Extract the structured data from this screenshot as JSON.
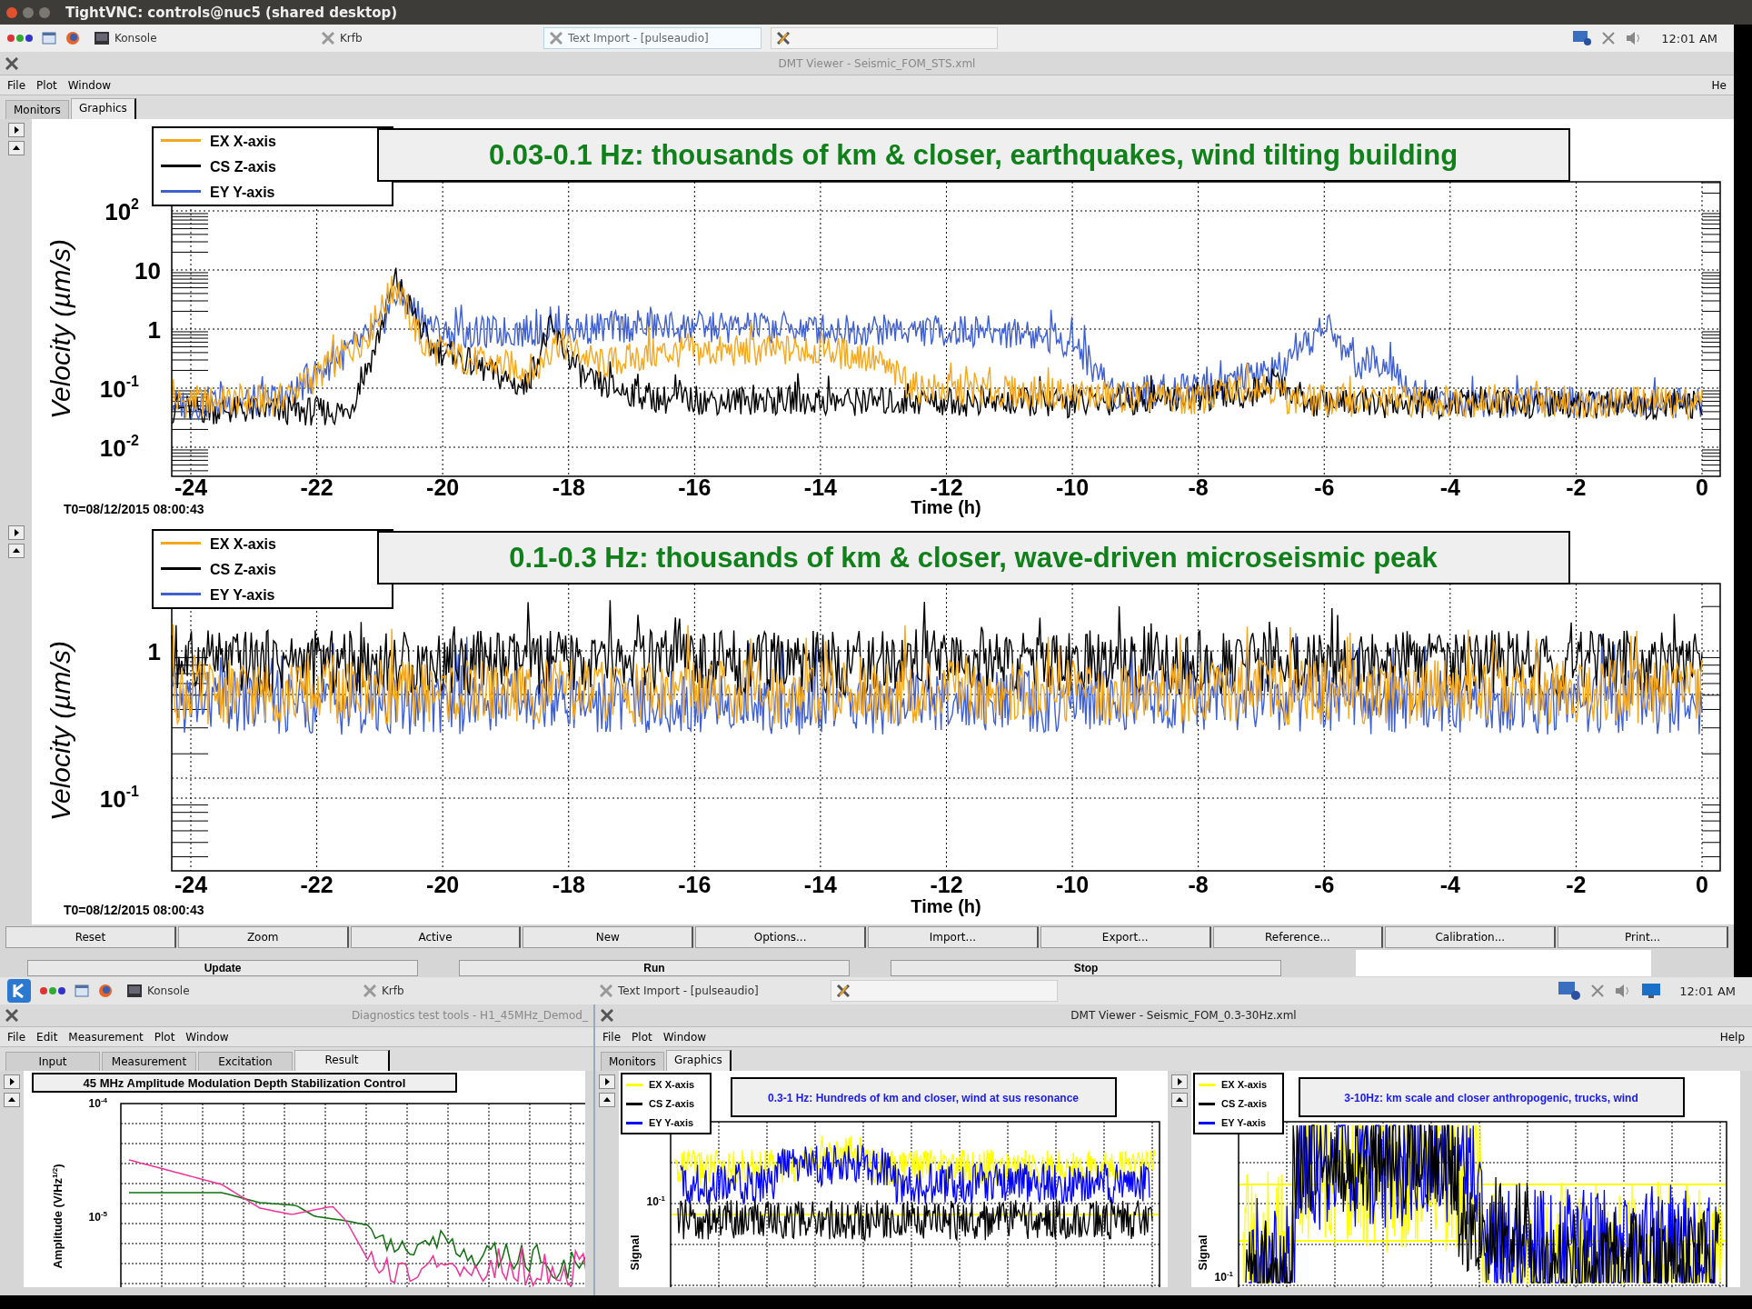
{
  "vnc_window": {
    "title": "TightVNC: controls@nuc5 (shared desktop)"
  },
  "taskbar_top": {
    "tasks": [
      {
        "label": "Konsole",
        "selected": false
      },
      {
        "label": "Krfb",
        "selected": false
      },
      {
        "label": "Text Import - [pulseaudio]",
        "selected": true
      }
    ],
    "clock": "12:01 AM"
  },
  "dmt_main": {
    "title": "DMT Viewer - Seismic_FOM_STS.xml",
    "menu": [
      "File",
      "Plot",
      "Window"
    ],
    "help": "He",
    "tabs": [
      {
        "label": "Monitors",
        "selected": false
      },
      {
        "label": "Graphics",
        "selected": true
      }
    ],
    "plots": [
      {
        "title": "0.03-0.1 Hz: thousands of km & closer, earthquakes, wind tilting building",
        "legend": [
          {
            "label": "EX X-axis",
            "color": "#f5a81c"
          },
          {
            "label": "CS Z-axis",
            "color": "#000000"
          },
          {
            "label": "EY Y-axis",
            "color": "#4060d0"
          }
        ],
        "ylabel": "Velocity  (µm/s)",
        "yticks": [
          {
            "base": "10",
            "exp": "2"
          },
          {
            "base": "10"
          },
          {
            "base": "1"
          },
          {
            "base": "10",
            "exp": "-1"
          },
          {
            "base": "10",
            "exp": "-2"
          }
        ],
        "xticks": [
          "-24",
          "-22",
          "-20",
          "-18",
          "-16",
          "-14",
          "-12",
          "-10",
          "-8",
          "-6",
          "-4",
          "-2",
          "0"
        ],
        "xlabel": "Time (h)",
        "t0": "T0=08/12/2015 08:00:43"
      },
      {
        "title": "0.1-0.3 Hz: thousands of km & closer, wave-driven microseismic peak",
        "legend": [
          {
            "label": "EX X-axis",
            "color": "#f5a81c"
          },
          {
            "label": "CS Z-axis",
            "color": "#000000"
          },
          {
            "label": "EY Y-axis",
            "color": "#4060d0"
          }
        ],
        "ylabel": "Velocity  (µm/s)",
        "yticks": [
          {
            "base": "1"
          },
          {
            "base": "10",
            "exp": "-1"
          }
        ],
        "xticks": [
          "-24",
          "-22",
          "-20",
          "-18",
          "-16",
          "-14",
          "-12",
          "-10",
          "-8",
          "-6",
          "-4",
          "-2",
          "0"
        ],
        "xlabel": "Time (h)",
        "t0": "T0=08/12/2015 08:00:43"
      }
    ],
    "buttons": [
      "Reset",
      "Zoom",
      "Active",
      "New",
      "Options...",
      "Import...",
      "Export...",
      "Reference...",
      "Calibration...",
      "Print..."
    ],
    "run_buttons": [
      "Update",
      "Run",
      "Stop"
    ]
  },
  "taskbar_bottom": {
    "tasks": [
      {
        "label": "Konsole",
        "selected": false
      },
      {
        "label": "Krfb",
        "selected": false
      },
      {
        "label": "Text Import - [pulseaudio]",
        "selected": false
      }
    ],
    "clock": "12:01 AM"
  },
  "diag_window": {
    "title": "Diagnostics test tools - H1_45MHz_Demod_",
    "menu": [
      "File",
      "Edit",
      "Measurement",
      "Plot",
      "Window"
    ],
    "tabs": [
      {
        "label": "Input",
        "selected": false
      },
      {
        "label": "Measurement",
        "selected": false
      },
      {
        "label": "Excitation",
        "selected": false
      },
      {
        "label": "Result",
        "selected": true
      }
    ],
    "plot": {
      "title": "45 MHz Amplitude Modulation Depth Stabilization Control",
      "ylabel": "Amplitude (V/Hz",
      "ylabel_sup": "1/2",
      "ylabel_tail": ")",
      "yticks": [
        {
          "base": "10",
          "exp": "-4"
        },
        {
          "base": "10",
          "exp": "-5"
        }
      ]
    }
  },
  "dmt_small": {
    "title": "DMT Viewer - Seismic_FOM_0.3-30Hz.xml",
    "menu": [
      "File",
      "Plot",
      "Window"
    ],
    "help": "Help",
    "tabs": [
      {
        "label": "Monitors",
        "selected": false
      },
      {
        "label": "Graphics",
        "selected": true
      }
    ],
    "plots": [
      {
        "title": "0.3-1 Hz: Hundreds of km and closer, wind at sus resonance",
        "legend": [
          {
            "label": "EX X-axis",
            "color": "#ffff00"
          },
          {
            "label": "CS Z-axis",
            "color": "#000000"
          },
          {
            "label": "EY Y-axis",
            "color": "#0000ff"
          }
        ],
        "ylabel": "Signal",
        "yticks": [
          {
            "base": "10",
            "exp": "-1"
          }
        ]
      },
      {
        "title": "3-10Hz: km scale and closer anthropogenic, trucks, wind",
        "legend": [
          {
            "label": "EX X-axis",
            "color": "#ffff00"
          },
          {
            "label": "CS Z-axis",
            "color": "#000000"
          },
          {
            "label": "EY Y-axis",
            "color": "#0000ff"
          }
        ],
        "ylabel": "Signal",
        "yticks": [
          {
            "base": "10",
            "exp": "-1"
          }
        ]
      }
    ]
  }
}
